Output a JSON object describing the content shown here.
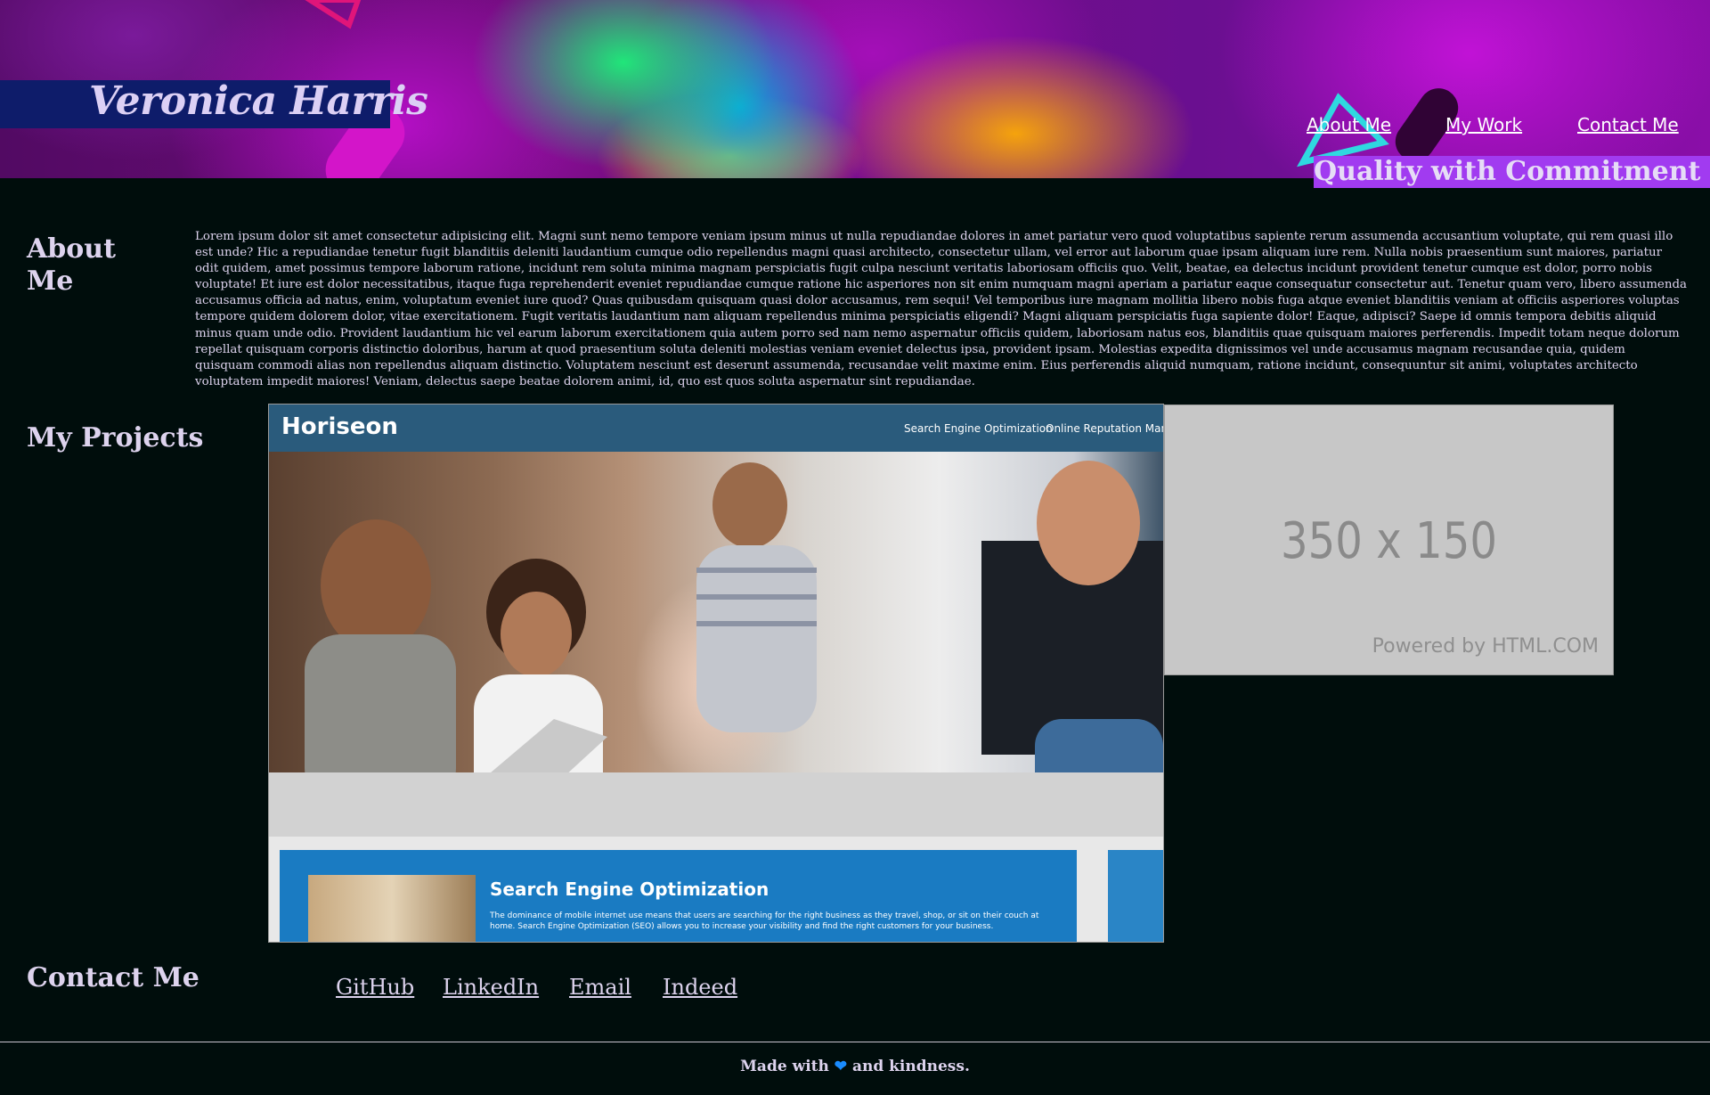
{
  "header": {
    "name": "Veronica Harris",
    "nav": [
      {
        "label": "About Me"
      },
      {
        "label": "My Work"
      },
      {
        "label": "Contact Me"
      }
    ],
    "tagline": "Quality with Commitment"
  },
  "about": {
    "title": "About Me",
    "text": "Lorem ipsum dolor sit amet consectetur adipisicing elit. Magni sunt nemo tempore veniam ipsum minus ut nulla repudiandae dolores in amet pariatur vero quod voluptatibus sapiente rerum assumenda accusantium voluptate, qui rem quasi illo est unde? Hic a repudiandae tenetur fugit blanditiis deleniti laudantium cumque odio repellendus magni quasi architecto, consectetur ullam, vel error aut laborum quae ipsam aliquam iure rem. Nulla nobis praesentium sunt maiores, pariatur odit quidem, amet possimus tempore laborum ratione, incidunt rem soluta minima magnam perspiciatis fugit culpa nesciunt veritatis laboriosam officiis quo. Velit, beatae, ea delectus incidunt provident tenetur cumque est dolor, porro nobis voluptate! Et iure est dolor necessitatibus, itaque fuga reprehenderit eveniet repudiandae cumque ratione hic asperiores non sit enim numquam magni aperiam a pariatur eaque consequatur consectetur aut. Tenetur quam vero, libero assumenda accusamus officia ad natus, enim, voluptatum eveniet iure quod? Quas quibusdam quisquam quasi dolor accusamus, rem sequi! Vel temporibus iure magnam mollitia libero nobis fuga atque eveniet blanditiis veniam at officiis asperiores voluptas tempore quidem dolorem dolor, vitae exercitationem. Fugit veritatis laudantium nam aliquam repellendus minima perspiciatis eligendi? Magni aliquam perspiciatis fuga sapiente dolor! Eaque, adipisci? Saepe id omnis tempora debitis aliquid minus quam unde odio. Provident laudantium hic vel earum laborum exercitationem quia autem porro sed nam nemo aspernatur officiis quidem, laboriosam natus eos, blanditiis quae quisquam maiores perferendis. Impedit totam neque dolorum repellat quisquam corporis distinctio doloribus, harum at quod praesentium soluta deleniti molestias veniam eveniet delectus ipsa, provident ipsam. Molestias expedita dignissimos vel unde accusamus magnam recusandae quia, quidem quisquam commodi alias non repellendus aliquam distinctio. Voluptatem nesciunt est deserunt assumenda, recusandae velit maxime enim. Eius perferendis aliquid numquam, ratione incidunt, consequuntur sit animi, voluptates architecto voluptatem impedit maiores! Veniam, delectus saepe beatae dolorem animi, id, quo est quos soluta aspernatur sint repudiandae."
  },
  "projects": {
    "title": "My Projects",
    "featured": {
      "logo": "Horiseon",
      "nav": [
        "Search Engine Optimization",
        "Online Reputation Manag"
      ],
      "seo_title": "Search Engine Optimization",
      "seo_text": "The dominance of mobile internet use means that users are searching for the right business as they travel, shop, or sit on their couch at home. Search Engine Optimization (SEO) allows you to increase your visibility and find the right customers for your business."
    },
    "placeholder": {
      "size": "350 x 150",
      "powered": "Powered by HTML.COM"
    }
  },
  "contact": {
    "title": "Contact Me",
    "links": [
      {
        "label": "GitHub"
      },
      {
        "label": "LinkedIn"
      },
      {
        "label": "Email"
      },
      {
        "label": "Indeed"
      }
    ]
  },
  "footer": {
    "text_before": "Made with",
    "icon": "heart-icon",
    "text_after": "and kindness."
  }
}
